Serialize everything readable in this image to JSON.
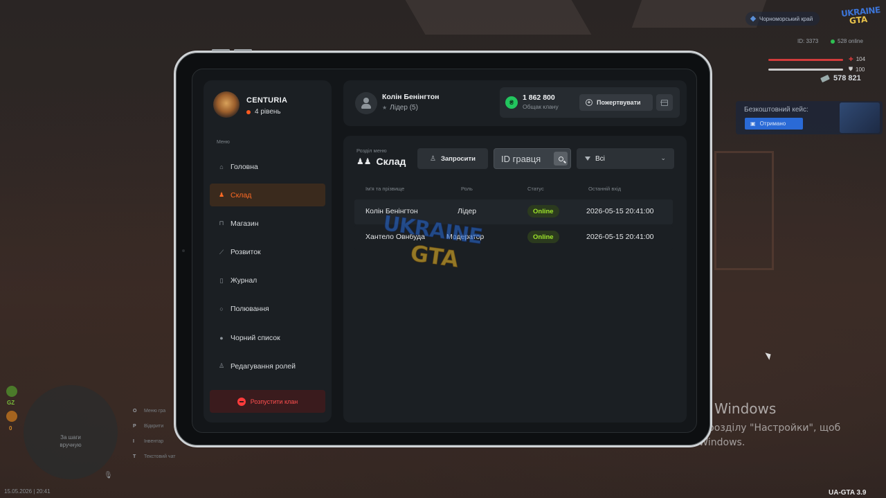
{
  "hud": {
    "region": "Чорноморський край",
    "logo_top": "UKRAINE",
    "logo_bottom": "GTA",
    "player_id": "ID: 3373",
    "online": "528 online",
    "health": "104",
    "armor": "100",
    "money": "578 821",
    "case_title": "Безкоштовний кейс:",
    "case_button": "Отримано",
    "minimap_text": "За шаги\nвручную",
    "gz_label": "GZ",
    "wanted_label": "0",
    "key_hints": [
      {
        "key": "O",
        "label": "Меню гра"
      },
      {
        "key": "P",
        "label": "Відкрити"
      },
      {
        "key": "I",
        "label": "Інвентар"
      },
      {
        "key": "T",
        "label": "Текстовий чат"
      }
    ],
    "datetime": "15.05.2026 | 20:41",
    "version": "UA-GTA 3.9"
  },
  "windows": {
    "title": "Активація Windows",
    "subtitle": "Перейдіть до розділу \"Настройки\", щоб активувати Windows."
  },
  "clan": {
    "name": "CENTURIA",
    "level": "4 рівень"
  },
  "menu": {
    "caption": "Меню",
    "items": [
      {
        "label": "Головна",
        "icon": "home-icon",
        "glyph": "⌂"
      },
      {
        "label": "Склад",
        "icon": "people-icon",
        "glyph": "♟"
      },
      {
        "label": "Магазин",
        "icon": "basket-icon",
        "glyph": "⊓"
      },
      {
        "label": "Розвиток",
        "icon": "chart-icon",
        "glyph": "⟋"
      },
      {
        "label": "Журнал",
        "icon": "book-icon",
        "glyph": "▯"
      },
      {
        "label": "Полювання",
        "icon": "target-icon",
        "glyph": "○"
      },
      {
        "label": "Чорний список",
        "icon": "ban-icon",
        "glyph": "●"
      },
      {
        "label": "Редагування ролей",
        "icon": "user-edit-icon",
        "glyph": "♙"
      }
    ],
    "disband_label": "Розпустити клан"
  },
  "header": {
    "user_name": "Колін Бенінгтон",
    "user_role": "Лідер (5)",
    "balance_value": "1 862 800",
    "balance_caption": "Общак клану",
    "coin_glyph": "₴",
    "donate_label": "Пожертвувати"
  },
  "section": {
    "caption": "Розділ меню",
    "title": "Склад",
    "invite_label": "Запросити",
    "search_placeholder": "ID гравця",
    "filter_value": "Всі"
  },
  "table": {
    "headers": [
      "Ім'я та прізвище",
      "Роль",
      "Статус",
      "Останній вхід"
    ],
    "rows": [
      {
        "name": "Колін Бенінгтон",
        "role": "Лідер",
        "status": "Online",
        "last_login": "2026-05-15 20:41:00"
      },
      {
        "name": "Хантело Овнбуда",
        "role": "Модератор",
        "status": "Online",
        "last_login": "2026-05-15 20:41:00"
      }
    ]
  },
  "watermark": {
    "top": "UKRAINE",
    "bottom": "GTA"
  }
}
